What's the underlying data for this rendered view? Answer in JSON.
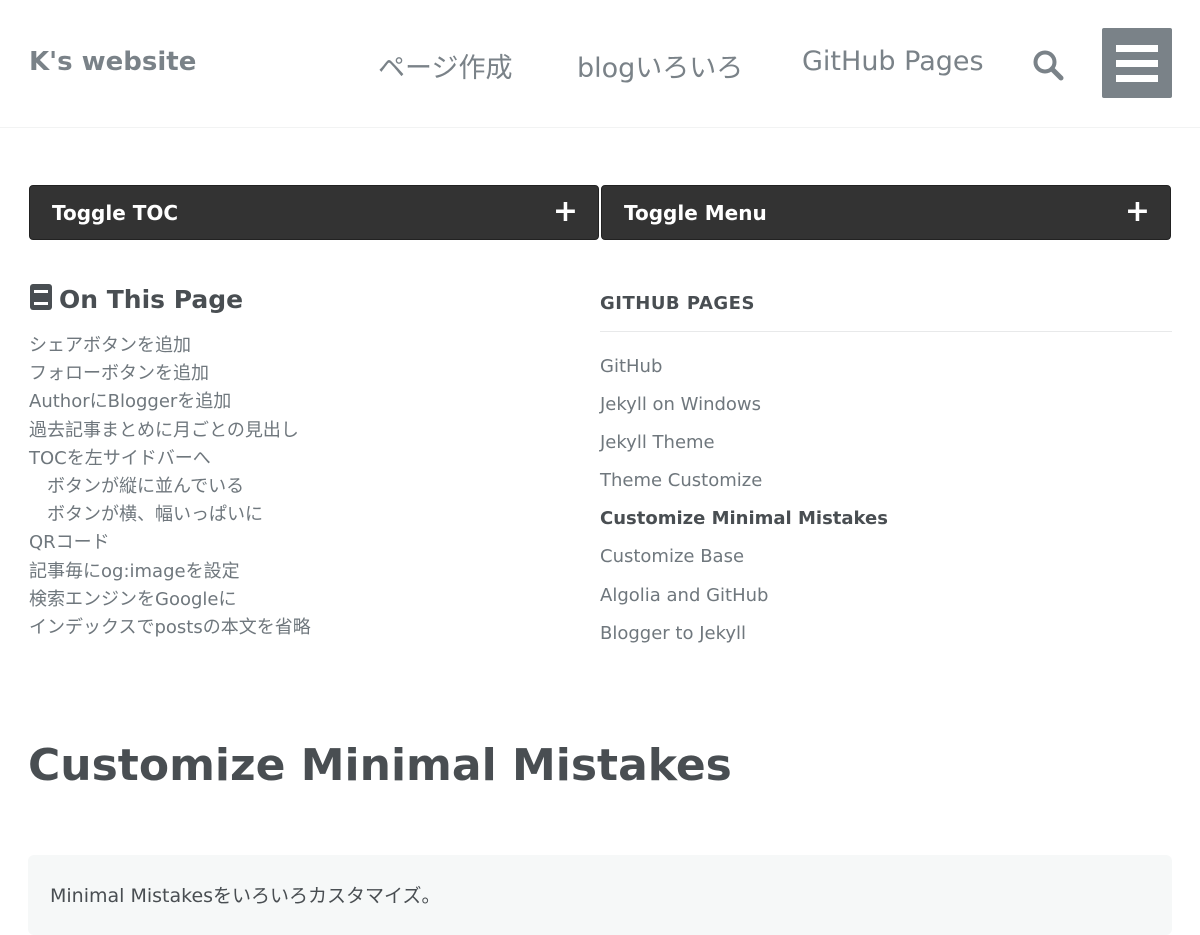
{
  "header": {
    "site_title": "K's website",
    "nav": [
      "ページ作成",
      "blogいろいろ",
      "GitHub Pages"
    ]
  },
  "toggles": {
    "toc_label": "Toggle TOC",
    "menu_label": "Toggle Menu",
    "icon": "+"
  },
  "toc": {
    "title": "On This Page",
    "icon": "book-icon",
    "items": [
      "シェアボタンを追加",
      "フォローボタンを追加",
      "AuthorにBloggerを追加",
      "過去記事まとめに月ごとの見出し",
      "TOCを左サイドバーへ",
      "ボタンが縦に並んでいる",
      "ボタンが横、幅いっぱいに",
      "QRコード",
      "記事毎にog:imageを設定",
      "検索エンジンをGoogleに",
      "インデックスでpostsの本文を省略"
    ]
  },
  "side_nav": {
    "heading": "GITHUB PAGES",
    "items": [
      "GitHub",
      "Jekyll on Windows",
      "Jekyll Theme",
      "Theme Customize",
      "Customize Minimal Mistakes",
      "Customize Base",
      "Algolia and GitHub",
      "Blogger to Jekyll"
    ],
    "active_index": 4
  },
  "main": {
    "title": "Customize Minimal Mistakes",
    "excerpt": "Minimal Mistakesをいろいろカスタマイズ。"
  },
  "colors": {
    "header_text": "#7a8288",
    "toggle_bg": "#333333",
    "body_text": "#494e52",
    "excerpt_bg": "#f6f8f8"
  }
}
